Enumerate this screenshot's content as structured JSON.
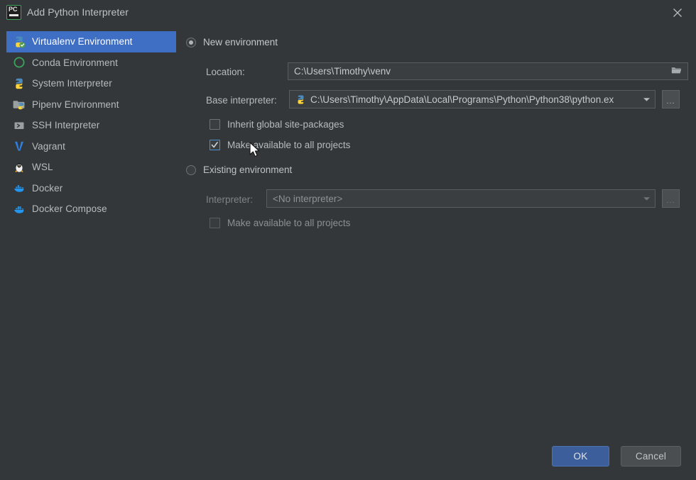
{
  "window": {
    "title": "Add Python Interpreter",
    "app_icon": "pycharm-icon",
    "close_icon": "close-icon",
    "background": "#333739",
    "accent": "#3f6fc4"
  },
  "sidebar": {
    "items": [
      {
        "label": "Virtualenv Environment",
        "icon": "virtualenv-icon",
        "selected": true
      },
      {
        "label": "Conda Environment",
        "icon": "conda-icon",
        "selected": false
      },
      {
        "label": "System Interpreter",
        "icon": "python-icon",
        "selected": false
      },
      {
        "label": "Pipenv Environment",
        "icon": "pipenv-icon",
        "selected": false
      },
      {
        "label": "SSH Interpreter",
        "icon": "ssh-icon",
        "selected": false
      },
      {
        "label": "Vagrant",
        "icon": "vagrant-icon",
        "selected": false
      },
      {
        "label": "WSL",
        "icon": "wsl-icon",
        "selected": false
      },
      {
        "label": "Docker",
        "icon": "docker-icon",
        "selected": false
      },
      {
        "label": "Docker Compose",
        "icon": "docker-compose-icon",
        "selected": false
      }
    ]
  },
  "main": {
    "new_environment": {
      "radio_label": "New environment",
      "selected": true,
      "location": {
        "label": "Location:",
        "value": "C:\\Users\\Timothy\\venv",
        "browse_icon": "folder-icon"
      },
      "base_interpreter": {
        "label": "Base interpreter:",
        "value": "C:\\Users\\Timothy\\AppData\\Local\\Programs\\Python\\Python38\\python.ex",
        "icon": "python-icon",
        "dropdown_icon": "chevron-down-icon",
        "browse_label": "..."
      },
      "inherit_site_packages": {
        "label": "Inherit global site-packages",
        "checked": false
      },
      "make_available": {
        "label": "Make available to all projects",
        "checked": true
      }
    },
    "existing_environment": {
      "radio_label": "Existing environment",
      "selected": false,
      "interpreter": {
        "label": "Interpreter:",
        "value": "<No interpreter>",
        "dropdown_icon": "chevron-down-icon",
        "browse_label": "..."
      },
      "make_available": {
        "label": "Make available to all projects",
        "checked": false
      }
    }
  },
  "footer": {
    "ok_label": "OK",
    "cancel_label": "Cancel"
  }
}
